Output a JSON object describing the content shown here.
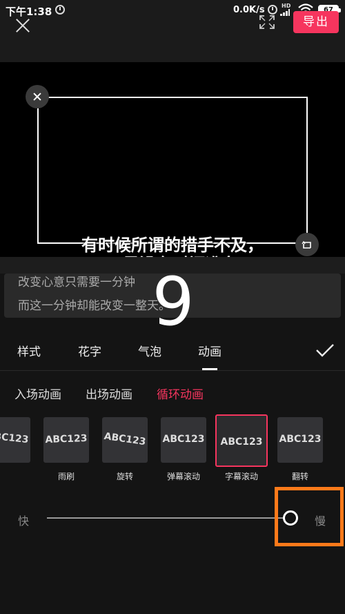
{
  "status_bar": {
    "time": "下午1:38",
    "net_speed": "0.0K/s",
    "network_type": "HD",
    "battery": "67",
    "icons": [
      "alarm-icon",
      "alarm-icon",
      "signal-icon",
      "wifi-icon",
      "battery-icon"
    ]
  },
  "toolbar": {
    "close_icon": "close-icon",
    "fullscreen_icon": "fullscreen-icon",
    "export_label": "导出",
    "accent_color": "#f6355e"
  },
  "preview": {
    "caption_line1": "有时候所谓的措手不及，",
    "caption_line2": "不是没有时间准备",
    "delete_icon": "close-icon",
    "rotate_icon": "rotate-icon"
  },
  "text_input": {
    "line1": "改变心意只需要一分钟",
    "line2": "而这一分钟却能改变一整天。"
  },
  "overlay_number": "9",
  "tabs": {
    "items": [
      {
        "label": "样式"
      },
      {
        "label": "花字"
      },
      {
        "label": "气泡"
      },
      {
        "label": "动画"
      }
    ],
    "active": "动画",
    "confirm_icon": "check-icon"
  },
  "sub_tabs": {
    "items": [
      {
        "label": "入场动画"
      },
      {
        "label": "出场动画"
      },
      {
        "label": "循环动画"
      }
    ],
    "active": "循环动画"
  },
  "animations": {
    "sample_text": "ABC123",
    "items": [
      {
        "label": ""
      },
      {
        "label": "雨刷"
      },
      {
        "label": "旋转"
      },
      {
        "label": "弹幕滚动"
      },
      {
        "label": "字幕滚动"
      },
      {
        "label": "翻转"
      }
    ],
    "selected": "字幕滚动"
  },
  "speed": {
    "fast_label": "快",
    "slow_label": "慢",
    "value": 0.97,
    "highlight_color": "#ff7a1a"
  }
}
